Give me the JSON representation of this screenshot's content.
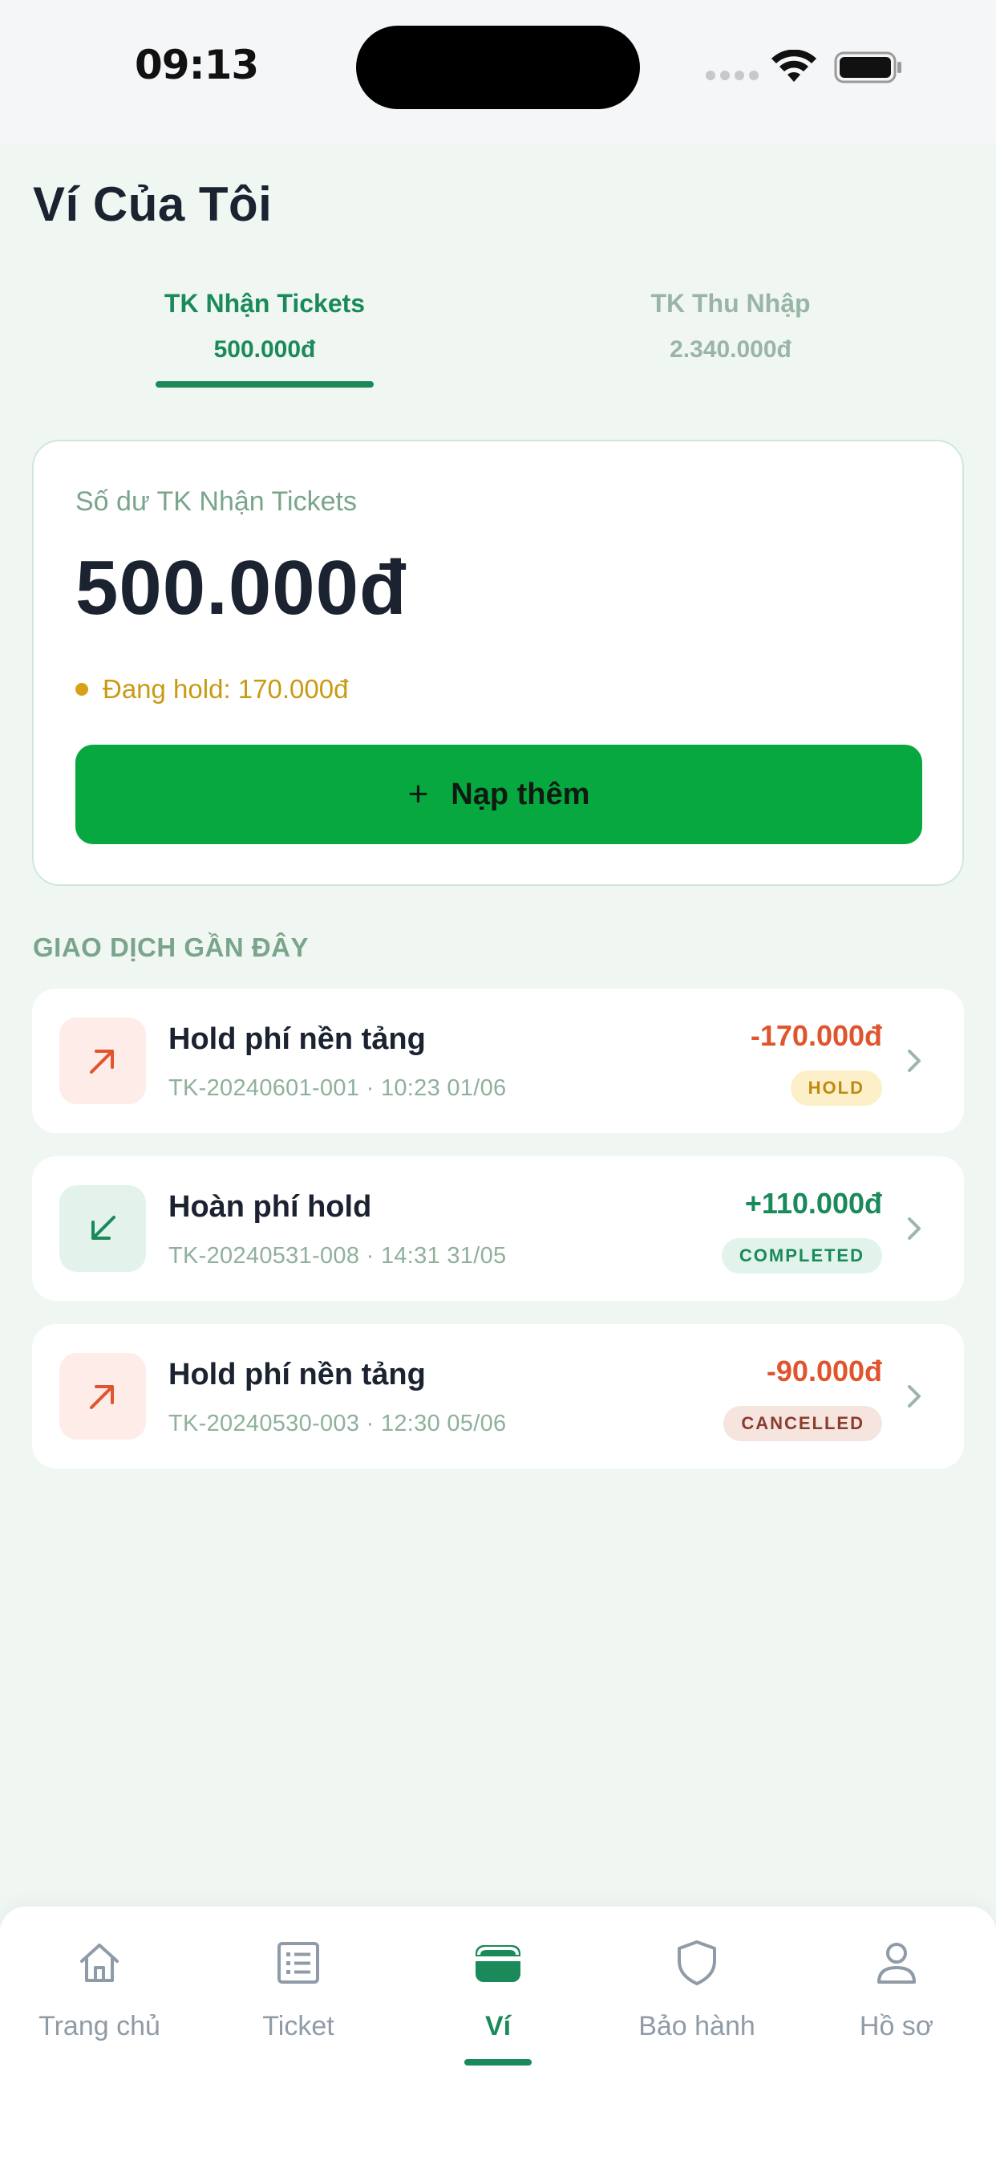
{
  "status_bar": {
    "time": "09:13"
  },
  "page": {
    "title": "Ví Của Tôi"
  },
  "account_tabs": [
    {
      "name": "TK Nhận Tickets",
      "amount": "500.000đ"
    },
    {
      "name": "TK Thu Nhập",
      "amount": "2.340.000đ"
    }
  ],
  "balance_card": {
    "label": "Số dư TK Nhận Tickets",
    "amount": "500.000đ",
    "hold_text": "Đang hold: 170.000đ",
    "topup_plus": "+",
    "topup_label": "Nạp thêm"
  },
  "transactions_section": {
    "title": "GIAO DỊCH GẦN ĐÂY",
    "items": [
      {
        "title": "Hold phí nền tảng",
        "subtitle": "TK-20240601-001 · 10:23 01/06",
        "amount": "-170.000đ",
        "status": "HOLD",
        "direction": "out"
      },
      {
        "title": "Hoàn phí hold",
        "subtitle": "TK-20240531-008 · 14:31 31/05",
        "amount": "+110.000đ",
        "status": "COMPLETED",
        "direction": "in"
      },
      {
        "title": "Hold phí nền tảng",
        "subtitle": "TK-20240530-003 · 12:30 05/06",
        "amount": "-90.000đ",
        "status": "CANCELLED",
        "direction": "out"
      }
    ]
  },
  "bottom_nav": {
    "items": [
      {
        "label": "Trang chủ",
        "icon": "home-icon"
      },
      {
        "label": "Ticket",
        "icon": "list-icon"
      },
      {
        "label": "Ví",
        "icon": "wallet-icon",
        "active": true
      },
      {
        "label": "Bảo hành",
        "icon": "shield-icon"
      },
      {
        "label": "Hồ sơ",
        "icon": "user-icon"
      }
    ]
  },
  "colors": {
    "accent": "#1a8a5a",
    "button": "#06a83f",
    "negative": "#e0552d",
    "hold": "#c99a14",
    "background": "#f0f7f3"
  }
}
